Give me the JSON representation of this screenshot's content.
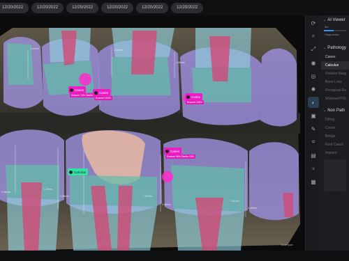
{
  "tabs": [
    "12/20/2022",
    "12/20/2022",
    "12/20/2022",
    "12/20/2022",
    "12/20/2022",
    "12/20/2022"
  ],
  "panel": {
    "ai_viewer_title": "AI Viewer",
    "ai_viewer_small": "Mo",
    "ai_viewer_small2": "Diagnostics",
    "slider_value": 0.45,
    "pathology_title": "Pathology",
    "pathology_items": [
      "Caries",
      "Calculus",
      "Notable Marg",
      "Bone Loss",
      "Periapical Ra",
      "Widened PDL"
    ],
    "non_pathology_title": "Non Path",
    "non_pathology_items": [
      "Filling",
      "Crown",
      "Bridge",
      "Root Canal",
      "Implant"
    ]
  },
  "tags": {
    "caries_1": "Caries",
    "caries_1_sub": "Enamel 74%\nDentin 27%",
    "caries_2": "Caries",
    "caries_2_sub": "Enamel 100%",
    "caries_3": "Caries",
    "caries_3_sub": "Enamel 100%",
    "caries_4": "Caries",
    "caries_4_sub": "Enamel 96%\nDentin 18%",
    "calculus": "Calculus"
  },
  "measurements": {
    "m1": "2.44mm",
    "m2": "2.45mm",
    "m3": "1.85mm",
    "m4": "1.08mm",
    "m5": "1.10mm",
    "m6": "1.39mm",
    "m7": "1.67mm",
    "m8": "1.36mm",
    "m9": "1.41mm",
    "m10": "1.49mm"
  },
  "viewer_footer": "Tooth part"
}
